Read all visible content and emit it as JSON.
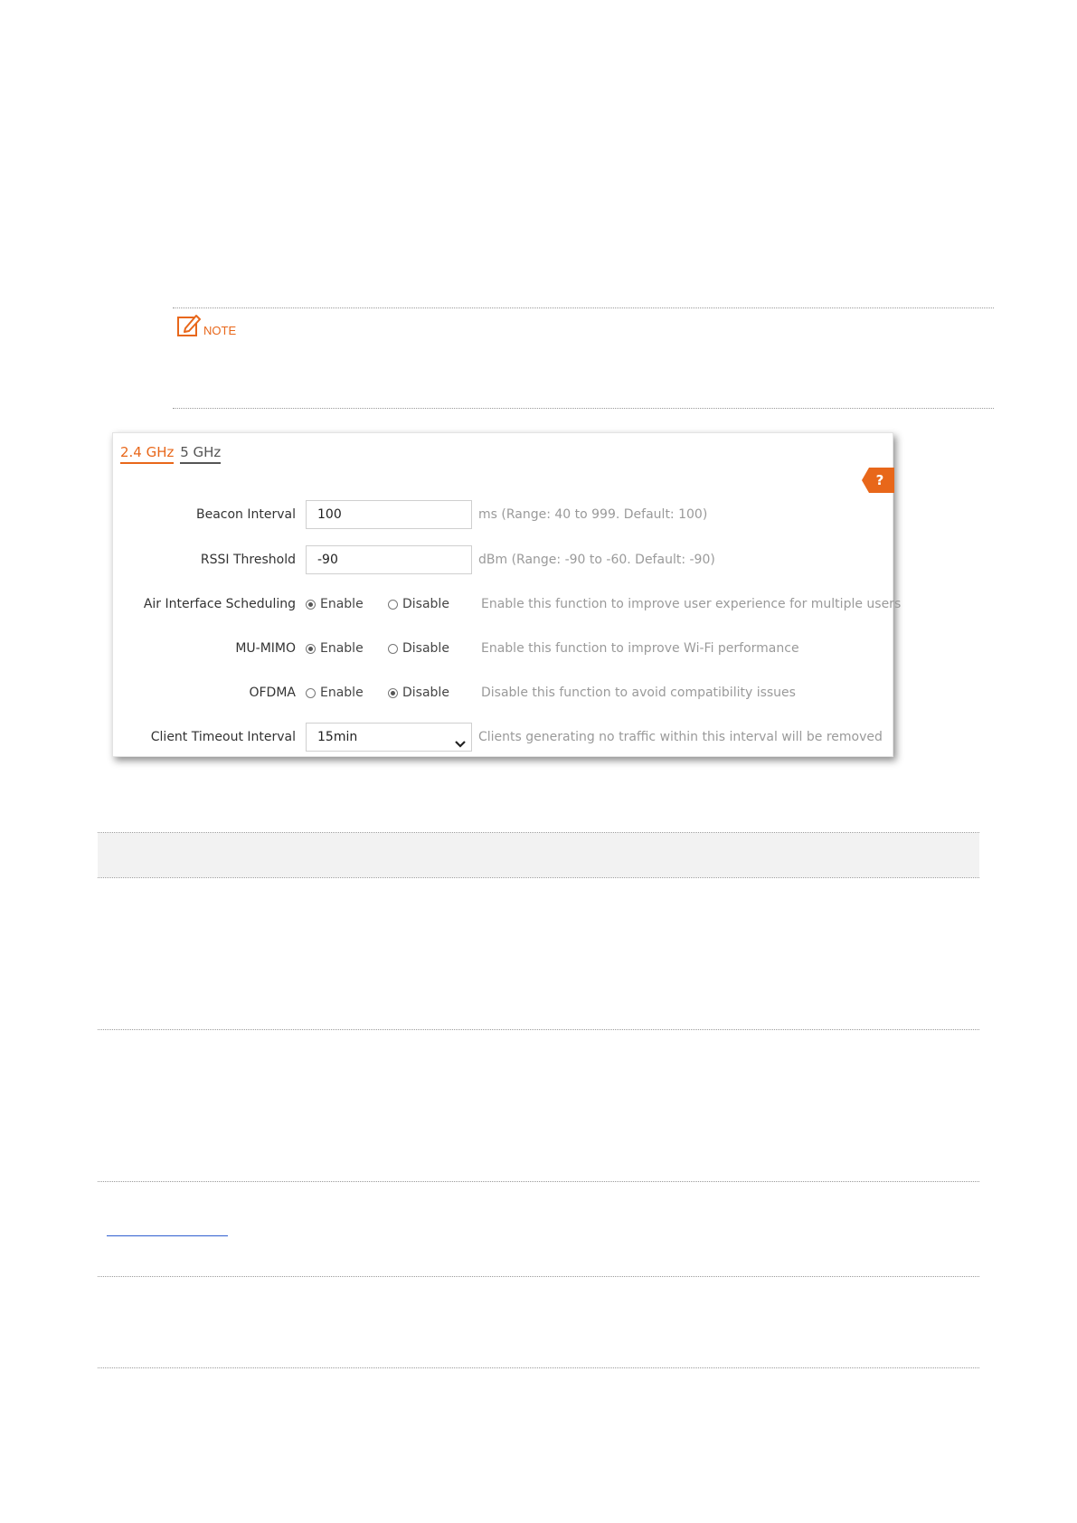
{
  "note": {
    "label": "NOTE",
    "icon": "note-edit-icon",
    "accent": "#e8671a"
  },
  "panel": {
    "tabs": [
      {
        "label": "2.4 GHz",
        "active": true
      },
      {
        "label": "5 GHz",
        "active": false
      }
    ],
    "help_label": "?",
    "beacon": {
      "label": "Beacon Interval",
      "value": "100",
      "hint": "ms (Range: 40 to 999. Default: 100)"
    },
    "rssi": {
      "label": "RSSI Threshold",
      "value": "-90",
      "hint": "dBm (Range: -90 to -60. Default: -90)"
    },
    "air": {
      "label": "Air Interface Scheduling",
      "enable": "Enable",
      "disable": "Disable",
      "selected": "Enable",
      "hint": "Enable this function to improve user experience for multiple users"
    },
    "mumimo": {
      "label": "MU-MIMO",
      "enable": "Enable",
      "disable": "Disable",
      "selected": "Enable",
      "hint": "Enable this function to improve Wi-Fi performance"
    },
    "ofdma": {
      "label": "OFDMA",
      "enable": "Enable",
      "disable": "Disable",
      "selected": "Disable",
      "hint": "Disable this function to avoid compatibility issues"
    },
    "timeout": {
      "label": "Client Timeout Interval",
      "value": "15min",
      "hint": "Clients generating no traffic within this interval will be removed"
    }
  },
  "colors": {
    "accent": "#e8671a",
    "hint_text": "#9a9a9a",
    "link": "#2f5fd0"
  }
}
